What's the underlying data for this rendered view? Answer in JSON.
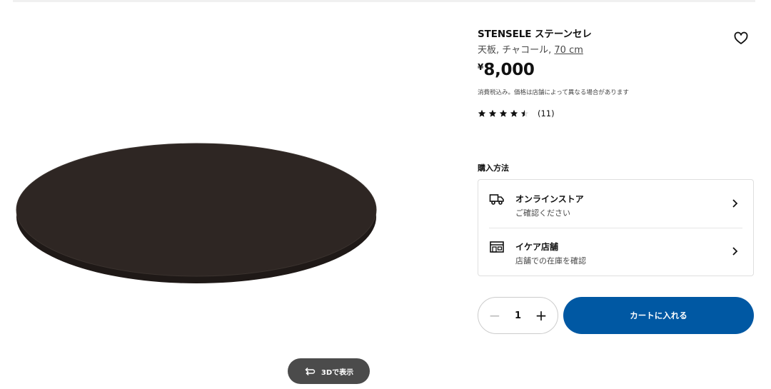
{
  "product": {
    "name": "STENSELE ステーンセレ",
    "desc_prefix": "天板, チャコール, ",
    "size": "70 cm",
    "currency": "¥",
    "price": "8,000",
    "tax_note": "消費税込み。価格は店舗によって異なる場合があります",
    "rating_value": 4.5,
    "review_count": "(11)"
  },
  "gallery": {
    "view3d_label": "3Dで表示"
  },
  "purchase": {
    "heading": "購入方法",
    "options": [
      {
        "title": "オンラインストア",
        "subtitle": "ご確認ください",
        "icon": "delivery-truck-icon"
      },
      {
        "title": "イケア店舗",
        "subtitle": "店舗での在庫を確認",
        "icon": "store-icon"
      }
    ]
  },
  "quantity": {
    "value": "1",
    "minus": "−",
    "plus": "+"
  },
  "cart": {
    "label": "カートに入れる"
  },
  "colors": {
    "accent": "#0058a3",
    "tabletop": "#2e2623",
    "button_dark": "#4b4b4b"
  }
}
